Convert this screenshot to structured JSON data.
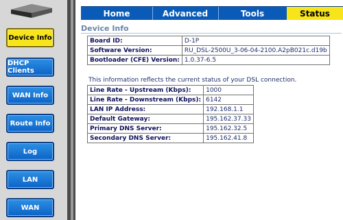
{
  "sidebar": {
    "items": [
      {
        "label": "Device Info",
        "active": true
      },
      {
        "label": "DHCP Clients",
        "active": false
      },
      {
        "label": "WAN Info",
        "active": false
      },
      {
        "label": "Route Info",
        "active": false
      },
      {
        "label": "Log",
        "active": false
      },
      {
        "label": "LAN",
        "active": false
      },
      {
        "label": "WAN",
        "active": false
      }
    ]
  },
  "tabs": [
    {
      "label": "Home"
    },
    {
      "label": "Advanced"
    },
    {
      "label": "Tools"
    },
    {
      "label": "Status",
      "active": true
    }
  ],
  "page": {
    "title": "Device Info",
    "note": "This information reflects the current status of your DSL connection."
  },
  "device_table": [
    {
      "label": "Board ID:",
      "value": "D-1P"
    },
    {
      "label": "Software Version:",
      "value": "RU_DSL-2500U_3-06-04-2100.A2pB021c.d19b"
    },
    {
      "label": "Bootloader (CFE) Version:",
      "value": "1.0.37-6.5"
    }
  ],
  "status_table": [
    {
      "label": "Line Rate - Upstream (Kbps):",
      "value": "1000"
    },
    {
      "label": "Line Rate - Downstream (Kbps):",
      "value": "6142"
    },
    {
      "label": "LAN IP Address:",
      "value": "192.168.1.1"
    },
    {
      "label": "Default Gateway:",
      "value": "195.162.37.33"
    },
    {
      "label": "Primary DNS Server:",
      "value": "195.162.32.5"
    },
    {
      "label": "Secondary DNS Server:",
      "value": "195.162.41.8"
    }
  ],
  "colors": {
    "accent_blue": "#0a5ab7",
    "active_yellow": "#f7e41a"
  }
}
